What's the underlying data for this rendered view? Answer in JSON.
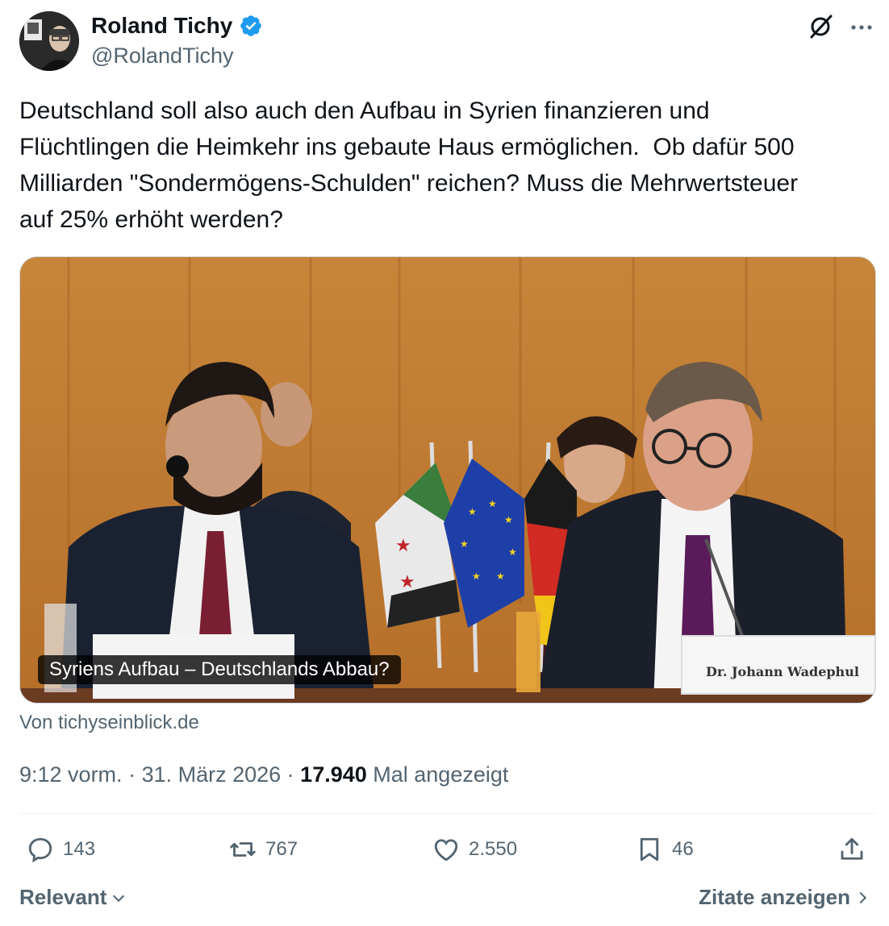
{
  "author": {
    "name": "Roland Tichy",
    "handle": "@RolandTichy"
  },
  "tweet": {
    "text": "Deutschland soll also auch den Aufbau in Syrien finanzieren und\nFlüchtlingen die Heimkehr ins gebaute Haus ermöglichen.  Ob dafür 500\nMilliarden \"Sondermögens-Schulden\" reichen? Muss die Mehrwertsteuer\nauf 25% erhöht werden?"
  },
  "card": {
    "title": "Syriens Aufbau – Deutschlands Abbau?",
    "source": "Von tichyseinblick.de",
    "nameplate": "Dr. Johann Wadephul"
  },
  "meta": {
    "time": "9:12 vorm.",
    "sep1": " · ",
    "date": "31. März 2026",
    "sep2": " · ",
    "views": "17.940",
    "views_label": " Mal angezeigt"
  },
  "actions": {
    "replies": "143",
    "reposts": "767",
    "likes": "2.550",
    "bookmarks": "46"
  },
  "footer": {
    "sort_label": "Relevant",
    "quotes_label": "Zitate anzeigen"
  },
  "colors": {
    "verified": "#1d9bf0",
    "secondary_text": "#536471",
    "primary_text": "#0f1419"
  }
}
